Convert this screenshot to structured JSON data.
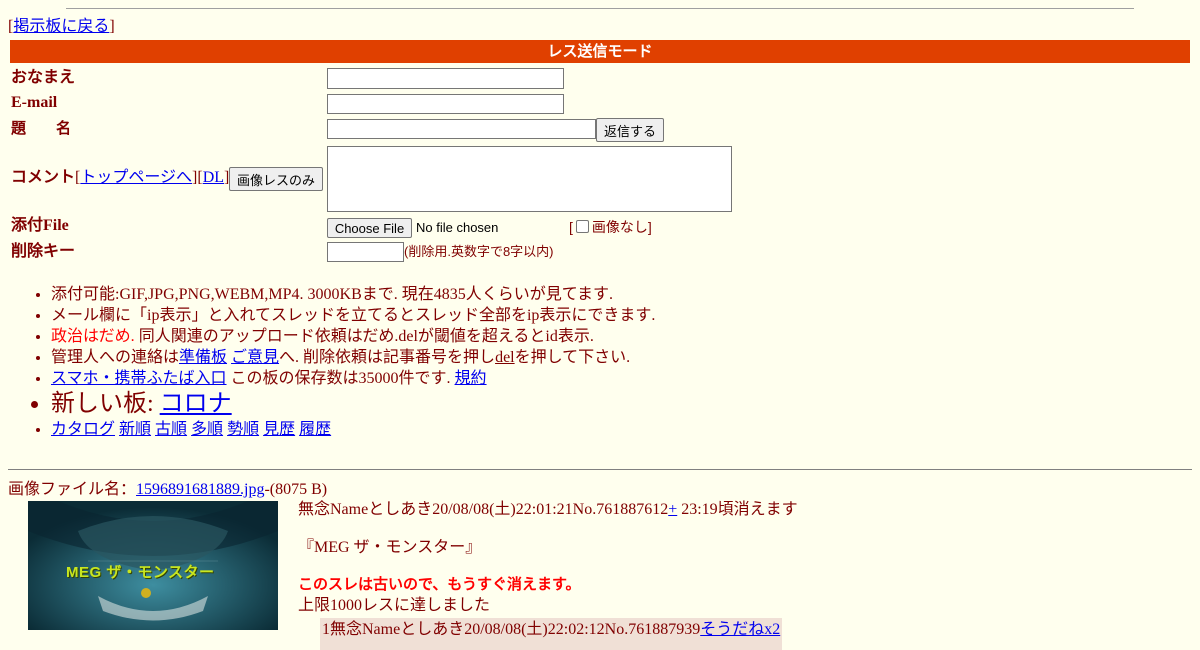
{
  "nav": {
    "back_open": "[",
    "back_link": "掲示板に戻る",
    "back_close": "]"
  },
  "mode_bar": "レス送信モード",
  "form": {
    "name_label": "おなまえ",
    "email_label": "E-mail",
    "subject_label": "題　　名",
    "submit_label": "返信する",
    "comment_label": "コメント",
    "comment_links": {
      "open1": "[",
      "top_page": "トップページへ",
      "mid": "][",
      "dl": "DL",
      "close": "]"
    },
    "image_only_label": "画像レスのみ",
    "attach_label": "添付File",
    "choose_file_label": "Choose File",
    "no_file_text": "No file chosen",
    "no_image_open": "[",
    "no_image_label": "画像なし",
    "no_image_close": "]",
    "delete_key_label": "削除キー",
    "delete_key_hint": "(削除用.英数字で8字以内)"
  },
  "info": {
    "line1": "添付可能:GIF,JPG,PNG,WEBM,MP4. 3000KBまで. 現在4835人くらいが見てます.",
    "line2": "メール欄に「ip表示」と入れてスレッドを立てるとスレッド全部をip表示にできます.",
    "line3_red": "政治はだめ.",
    "line3_rest": " 同人関連のアップロード依頼はだめ.delが閾値を超えるとid表示.",
    "line4_pre": "管理人への連絡は",
    "line4_link1": "準備板",
    "line4_sp": " ",
    "line4_link2": "ご意見",
    "line4_mid": "へ. 削除依頼は記事番号を押し",
    "line4_link3": "del",
    "line4_post": "を押して下さい.",
    "line5_link1": "スマホ・携帯ふたば入口",
    "line5_mid": " この板の保存数は35000件です. ",
    "line5_link2": "規約",
    "line6_pre": "新しい板: ",
    "line6_link": "コロナ",
    "catalog_links": [
      "カタログ",
      "新順",
      "古順",
      "多順",
      "勢順",
      "見歴",
      "履歴"
    ]
  },
  "post": {
    "file_prefix": "画像ファイル名：",
    "file_link": "1596891681889.jpg",
    "file_size": "-(8075 B)",
    "thumb_text": "MEG ザ・モンスター",
    "header": "無念Nameとしあき20/08/08(土)22:01:21No.761887612",
    "plus": "+",
    "expire": " 23:19頃消えます",
    "title": "『MEG ザ・モンスター』",
    "warning": "このスレは古いので、もうすぐ消えます。",
    "limit": "上限1000レスに達しました",
    "reply_header": "1無念Nameとしあき20/08/08(土)22:02:12No.761887939",
    "reply_sodane": "そうだねx2"
  }
}
